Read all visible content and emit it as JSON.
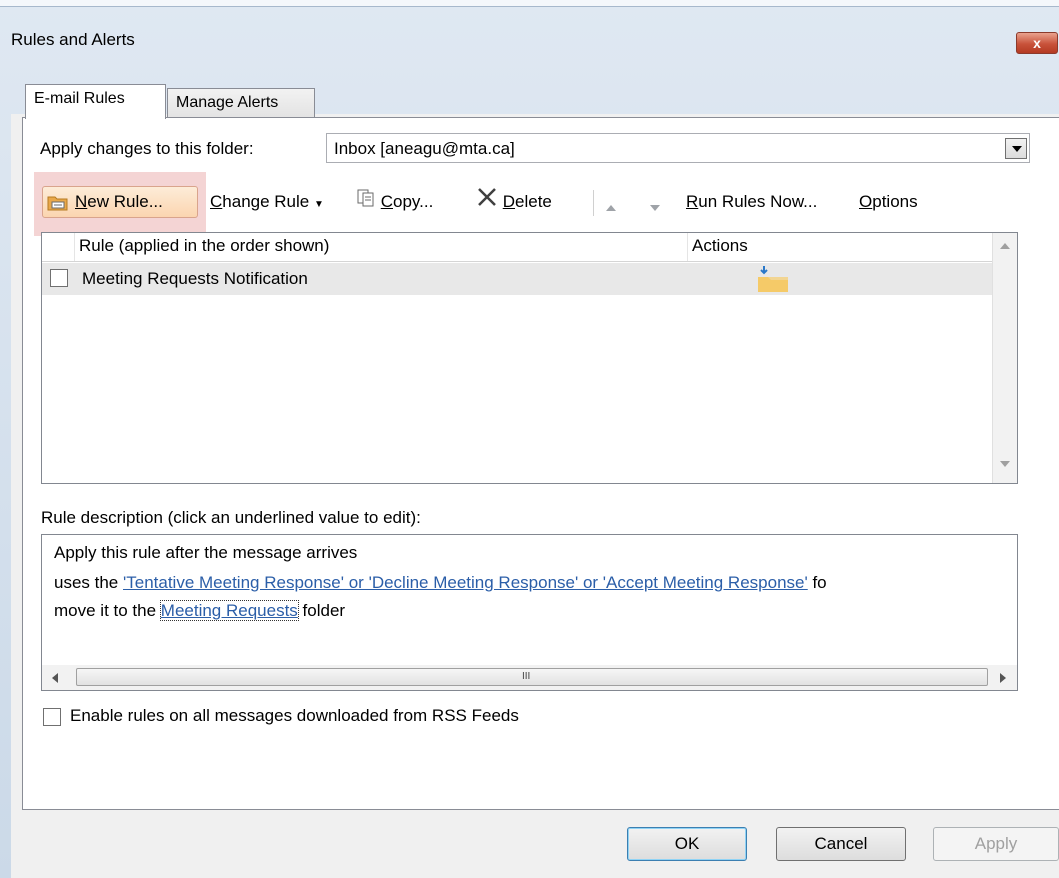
{
  "window": {
    "title": "Rules and Alerts",
    "close_glyph": "x"
  },
  "tabs": [
    {
      "label": "E-mail Rules"
    },
    {
      "label": "Manage Alerts"
    }
  ],
  "folder": {
    "label": "Apply changes to this folder:",
    "value": "Inbox [aneagu@mta.ca]"
  },
  "toolbar": {
    "new_rule_pre": "",
    "new_rule_key": "N",
    "new_rule_post": "ew Rule...",
    "change_rule_pre": "",
    "change_rule_key": "C",
    "change_rule_post": "hange Rule",
    "copy_pre": "",
    "copy_key": "C",
    "copy_post": "opy...",
    "delete_pre": "",
    "delete_key": "D",
    "delete_post": "elete",
    "run_pre": "",
    "run_key": "R",
    "run_post": "un Rules Now...",
    "options_pre": "",
    "options_key": "O",
    "options_post": "ptions"
  },
  "rules_list": {
    "col_rule": "Rule (applied in the order shown)",
    "col_actions": "Actions",
    "rows": [
      {
        "name": "Meeting Requests Notification",
        "checked": false,
        "action_icon": "move-to-folder-icon"
      }
    ]
  },
  "description": {
    "label": "Rule description (click an underlined value to edit):",
    "line1": "Apply this rule after the message arrives",
    "line2_pre": "uses the ",
    "line2_link": "'Tentative Meeting Response' or 'Decline Meeting Response' or 'Accept Meeting Response'",
    "line2_post": " fo",
    "line3_pre": "move it to the ",
    "line3_link": "Meeting Requests",
    "line3_post": " folder",
    "scroll_grip": "III"
  },
  "rss": {
    "label": "Enable rules on all messages downloaded from RSS Feeds",
    "checked": false
  },
  "buttons": {
    "ok": "OK",
    "cancel": "Cancel",
    "apply": "Apply"
  },
  "colors": {
    "link": "#2b5ea8",
    "highlight": "#f4d4d4",
    "title_bar": "#dfe8f2"
  }
}
